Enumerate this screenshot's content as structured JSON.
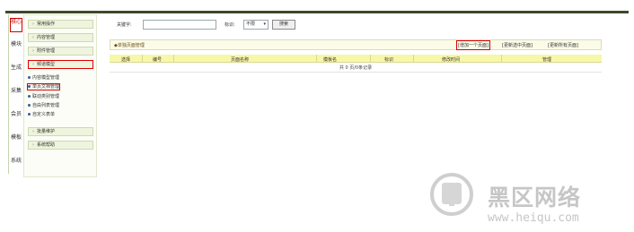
{
  "vtabs": [
    "核心",
    "模块",
    "生成",
    "采集",
    "会员",
    "模板",
    "系统"
  ],
  "sidebar": {
    "headers": [
      {
        "label": "常用操作",
        "active": false
      },
      {
        "label": "内容管理",
        "active": false
      },
      {
        "label": "附件管理",
        "active": false
      },
      {
        "label": "频道模型",
        "active": true
      }
    ],
    "subitems": [
      {
        "label": "内容模型管理",
        "highlighted": false
      },
      {
        "label": "单页文档管理",
        "highlighted": true
      },
      {
        "label": "联动类别管理",
        "highlighted": false
      },
      {
        "label": "自由列表管理",
        "highlighted": false
      },
      {
        "label": "自定义表单",
        "highlighted": false
      }
    ],
    "lower_headers": [
      {
        "label": "批量维护"
      },
      {
        "label": "系统帮助"
      }
    ]
  },
  "search": {
    "keyword_label": "关键字:",
    "keyword_value": "",
    "category_label": "标识:",
    "category_selected": "不限",
    "search_button": "搜索"
  },
  "list": {
    "title": "◆单独页面管理",
    "actions": [
      {
        "label": "[增加一个页面]",
        "boxed": true
      },
      {
        "label": "[更新选中页面]",
        "boxed": false
      },
      {
        "label": "[更新所有页面]",
        "boxed": false
      }
    ],
    "columns": [
      "选择",
      "编号",
      "页面名称",
      "模板名",
      "标识",
      "修改时间",
      "管理"
    ],
    "empty_text": "共 0 页/0条记录"
  },
  "watermark": {
    "brand": "黑区网络",
    "url": "www.heiqu.com"
  },
  "colors": {
    "header_bar": "#3b4a2a",
    "highlight_box": "#dd0000",
    "table_header": "#f7f7a8",
    "sidebar_bg": "#fbfdf6"
  }
}
